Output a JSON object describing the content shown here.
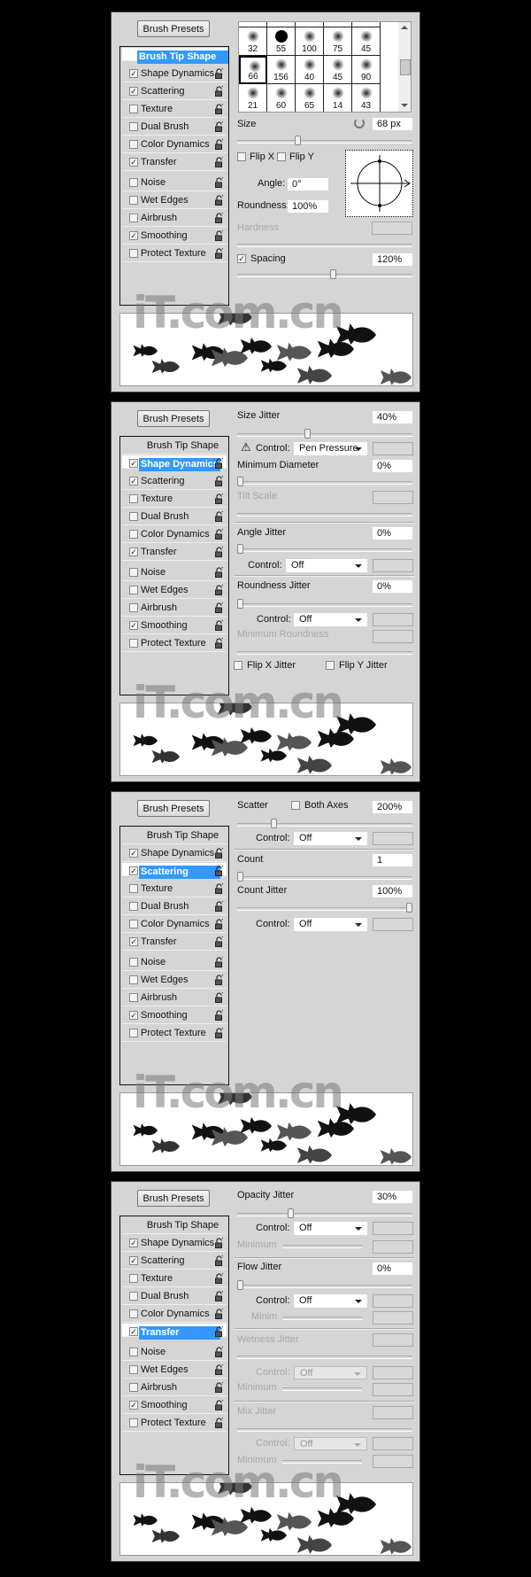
{
  "brush_presets_label": "Brush Presets",
  "brush_tip_label": "Brush Tip Shape",
  "options": [
    {
      "label": "Shape Dynamics",
      "checked": true
    },
    {
      "label": "Scattering",
      "checked": true
    },
    {
      "label": "Texture",
      "checked": false
    },
    {
      "label": "Dual Brush",
      "checked": false
    },
    {
      "label": "Color Dynamics",
      "checked": false
    },
    {
      "label": "Transfer",
      "checked": true
    },
    {
      "label": "Noise",
      "checked": false
    },
    {
      "label": "Wet Edges",
      "checked": false
    },
    {
      "label": "Airbrush",
      "checked": false
    },
    {
      "label": "Smoothing",
      "checked": true
    },
    {
      "label": "Protect Texture",
      "checked": false
    }
  ],
  "watermark": "iT.com.cn",
  "colors": {
    "highlight": "#3399ff",
    "panel": "#d5d5d5"
  },
  "panels": [
    {
      "selected": "Brush Tip Shape",
      "brush_grid": {
        "rows": [
          [
            "32",
            "55",
            "100",
            "75",
            "45"
          ],
          [
            "66",
            "156",
            "40",
            "45",
            "90"
          ],
          [
            "21",
            "60",
            "65",
            "14",
            "43"
          ]
        ],
        "selected": "66"
      },
      "size": {
        "label": "Size",
        "value": "68 px",
        "slider": 0.34
      },
      "flip_x": {
        "label": "Flip X",
        "checked": false
      },
      "flip_y": {
        "label": "Flip Y",
        "checked": false
      },
      "angle": {
        "label": "Angle:",
        "value": "0°"
      },
      "roundness": {
        "label": "Roundness:",
        "value": "100%"
      },
      "hardness": {
        "label": "Hardness"
      },
      "spacing": {
        "label": "Spacing",
        "checked": true,
        "value": "120%",
        "slider": 0.55
      }
    },
    {
      "selected": "Shape Dynamics",
      "size_jitter": {
        "label": "Size Jitter",
        "value": "40%",
        "slider": 0.4
      },
      "control1": {
        "label": "Control:",
        "value": "Pen Pressure"
      },
      "min_diameter": {
        "label": "Minimum Diameter",
        "value": "0%",
        "slider": 0
      },
      "tilt_scale": {
        "label": "Tilt Scale"
      },
      "angle_jitter": {
        "label": "Angle Jitter",
        "value": "0%",
        "slider": 0
      },
      "control2": {
        "label": "Control:",
        "value": "Off"
      },
      "roundness_jitter": {
        "label": "Roundness Jitter",
        "value": "0%",
        "slider": 0
      },
      "control3": {
        "label": "Control:",
        "value": "Off"
      },
      "min_roundness": {
        "label": "Minimum Roundness"
      },
      "flip_x_jitter": {
        "label": "Flip X Jitter",
        "checked": false
      },
      "flip_y_jitter": {
        "label": "Flip Y Jitter",
        "checked": false
      }
    },
    {
      "selected": "Scattering",
      "scatter": {
        "label": "Scatter",
        "value": "200%",
        "slider": 0.2
      },
      "both_axes": {
        "label": "Both Axes",
        "checked": false
      },
      "control1": {
        "label": "Control:",
        "value": "Off"
      },
      "count": {
        "label": "Count",
        "value": "1",
        "slider": 0
      },
      "count_jitter": {
        "label": "Count Jitter",
        "value": "100%",
        "slider": 1
      },
      "control2": {
        "label": "Control:",
        "value": "Off"
      }
    },
    {
      "selected": "Transfer",
      "opacity_jitter": {
        "label": "Opacity Jitter",
        "value": "30%",
        "slider": 0.3
      },
      "control1": {
        "label": "Control:",
        "value": "Off"
      },
      "minimum1": {
        "label": "Minimum"
      },
      "flow_jitter": {
        "label": "Flow Jitter",
        "value": "0%",
        "slider": 0
      },
      "control2": {
        "label": "Control:",
        "value": "Off"
      },
      "minimum2": {
        "label": "Minim"
      },
      "wetness_jitter": {
        "label": "Wetness Jitter"
      },
      "control3": {
        "label": "Control:",
        "value": "Off"
      },
      "minimum3": {
        "label": "Minimum"
      },
      "mix_jitter": {
        "label": "Mix Jitter"
      },
      "control4": {
        "label": "Control:",
        "value": "Off"
      },
      "minimum4": {
        "label": "Minimum"
      }
    }
  ]
}
